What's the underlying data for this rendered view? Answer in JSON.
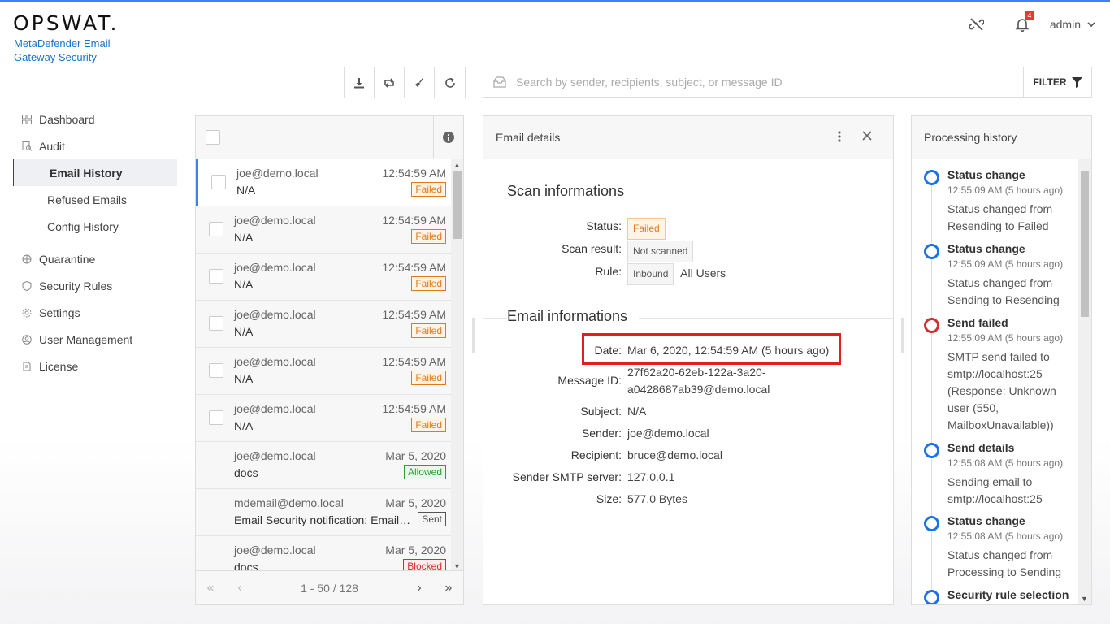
{
  "header": {
    "logo": "OPSWAT.",
    "product": "MetaDefender Email Gateway Security",
    "notification_count": "4",
    "user": "admin"
  },
  "sidebar": {
    "items": [
      {
        "label": "Dashboard",
        "icon": "dashboard-icon"
      },
      {
        "label": "Audit",
        "icon": "audit-icon"
      },
      {
        "label": "Email History",
        "sub": true,
        "active": true
      },
      {
        "label": "Refused Emails",
        "sub": true
      },
      {
        "label": "Config History",
        "sub": true
      },
      {
        "label": "Quarantine",
        "icon": "quarantine-icon"
      },
      {
        "label": "Security Rules",
        "icon": "shield-icon"
      },
      {
        "label": "Settings",
        "icon": "gear-icon"
      },
      {
        "label": "User Management",
        "icon": "user-icon"
      },
      {
        "label": "License",
        "icon": "license-icon"
      }
    ]
  },
  "toolbar": {
    "buttons": [
      "download-icon",
      "retweet-icon",
      "broom-icon",
      "refresh-icon"
    ]
  },
  "search": {
    "placeholder": "Search by sender, recipients, subject, or message ID",
    "value": "",
    "filter_label": "FILTER"
  },
  "email_list": {
    "rows": [
      {
        "from": "joe@demo.local",
        "time": "12:54:59 AM",
        "subject": "N/A",
        "status": "Failed",
        "selected": true,
        "checkbox": true
      },
      {
        "from": "joe@demo.local",
        "time": "12:54:59 AM",
        "subject": "N/A",
        "status": "Failed",
        "checkbox": true
      },
      {
        "from": "joe@demo.local",
        "time": "12:54:59 AM",
        "subject": "N/A",
        "status": "Failed",
        "checkbox": true
      },
      {
        "from": "joe@demo.local",
        "time": "12:54:59 AM",
        "subject": "N/A",
        "status": "Failed",
        "checkbox": true
      },
      {
        "from": "joe@demo.local",
        "time": "12:54:59 AM",
        "subject": "N/A",
        "status": "Failed",
        "checkbox": true
      },
      {
        "from": "joe@demo.local",
        "time": "12:54:59 AM",
        "subject": "N/A",
        "status": "Failed",
        "checkbox": true
      },
      {
        "from": "joe@demo.local",
        "time": "Mar 5, 2020",
        "subject": "docs",
        "status": "Allowed",
        "checkbox": false
      },
      {
        "from": "mdemail@demo.local",
        "time": "Mar 5, 2020",
        "subject": "Email Security notification: Email Blocked",
        "status": "Sent",
        "checkbox": false
      },
      {
        "from": "joe@demo.local",
        "time": "Mar 5, 2020",
        "subject": "docs",
        "status": "Blocked",
        "checkbox": false
      }
    ],
    "pagination": "1 - 50 / 128"
  },
  "email_details": {
    "title": "Email details",
    "scan_section": "Scan informations",
    "email_section": "Email informations",
    "labels": {
      "status": "Status:",
      "scan_result": "Scan result:",
      "rule": "Rule:",
      "date": "Date:",
      "message_id": "Message ID:",
      "subject": "Subject:",
      "sender": "Sender:",
      "recipient": "Recipient:",
      "smtp": "Sender SMTP server:",
      "size": "Size:"
    },
    "values": {
      "status": "Failed",
      "scan_result": "Not scanned",
      "rule_tag": "Inbound",
      "rule_users": "All Users",
      "date": "Mar 6, 2020, 12:54:59 AM (5 hours ago)",
      "message_id_1": "27f62a20-62eb-122a-3a20-",
      "message_id_2": "a0428687ab39@demo.local",
      "subject": "N/A",
      "sender": "joe@demo.local",
      "recipient": "bruce@demo.local",
      "smtp": "127.0.0.1",
      "size": "577.0 Bytes"
    }
  },
  "history": {
    "title": "Processing history",
    "events": [
      {
        "title": "Status change",
        "time": "12:55:09 AM (5 hours ago)",
        "desc": "Status changed from Resending to Failed",
        "color": "blue"
      },
      {
        "title": "Status change",
        "time": "12:55:09 AM (5 hours ago)",
        "desc": "Status changed from Sending to Resending",
        "color": "blue"
      },
      {
        "title": "Send failed",
        "time": "12:55:09 AM (5 hours ago)",
        "desc": "SMTP send failed to smtp://localhost:25 (Response: Unknown user (550, MailboxUnavailable))",
        "color": "red"
      },
      {
        "title": "Send details",
        "time": "12:55:08 AM (5 hours ago)",
        "desc": "Sending email to smtp://localhost:25",
        "color": "blue"
      },
      {
        "title": "Status change",
        "time": "12:55:08 AM (5 hours ago)",
        "desc": "Status changed from Processing to Sending",
        "color": "blue"
      },
      {
        "title": "Security rule selection",
        "time": "",
        "desc": "",
        "color": "blue"
      }
    ]
  },
  "colors": {
    "accent": "#1a73e8",
    "failed": "#e07b1a",
    "allowed": "#2e9e3a",
    "blocked": "#d32f2f",
    "highlight": "#e02020"
  }
}
